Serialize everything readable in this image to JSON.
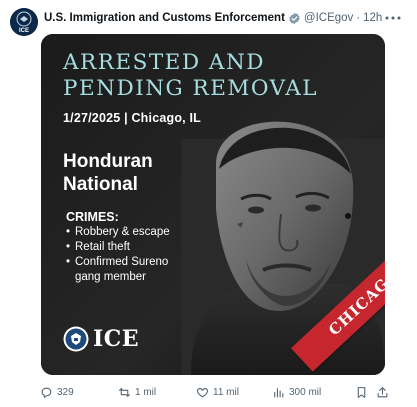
{
  "author": {
    "display_name": "U.S. Immigration and Customs Enforcement",
    "handle": "@ICEgov",
    "separator": "·",
    "time": "12h",
    "avatar_text": "ICE",
    "verified_color": "#829aab"
  },
  "icons": {
    "more": "more-options-icon",
    "reply": "reply-icon",
    "repost": "repost-icon",
    "like": "heart-icon",
    "views": "views-chart-icon",
    "bookmark": "bookmark-icon",
    "share": "share-icon"
  },
  "media": {
    "headline_line1": "ARRESTED AND",
    "headline_line2": "PENDING REMOVAL",
    "dateline": "1/27/2025 | Chicago, IL",
    "nationality_line1": "Honduran",
    "nationality_line2": "National",
    "crimes_title": "CRIMES:",
    "crimes": [
      "Robbery & escape",
      "Retail theft",
      "Confirmed Sureno",
      "gang member"
    ],
    "agency_name": "ICE",
    "banner_text": "CHICAGO",
    "colors": {
      "headline": "#a6dde0",
      "banner": "#c6262d",
      "background": "#141414"
    }
  },
  "actions": {
    "replies": "329",
    "reposts": "1 mil",
    "likes": "11 mil",
    "views": "300 mil"
  }
}
